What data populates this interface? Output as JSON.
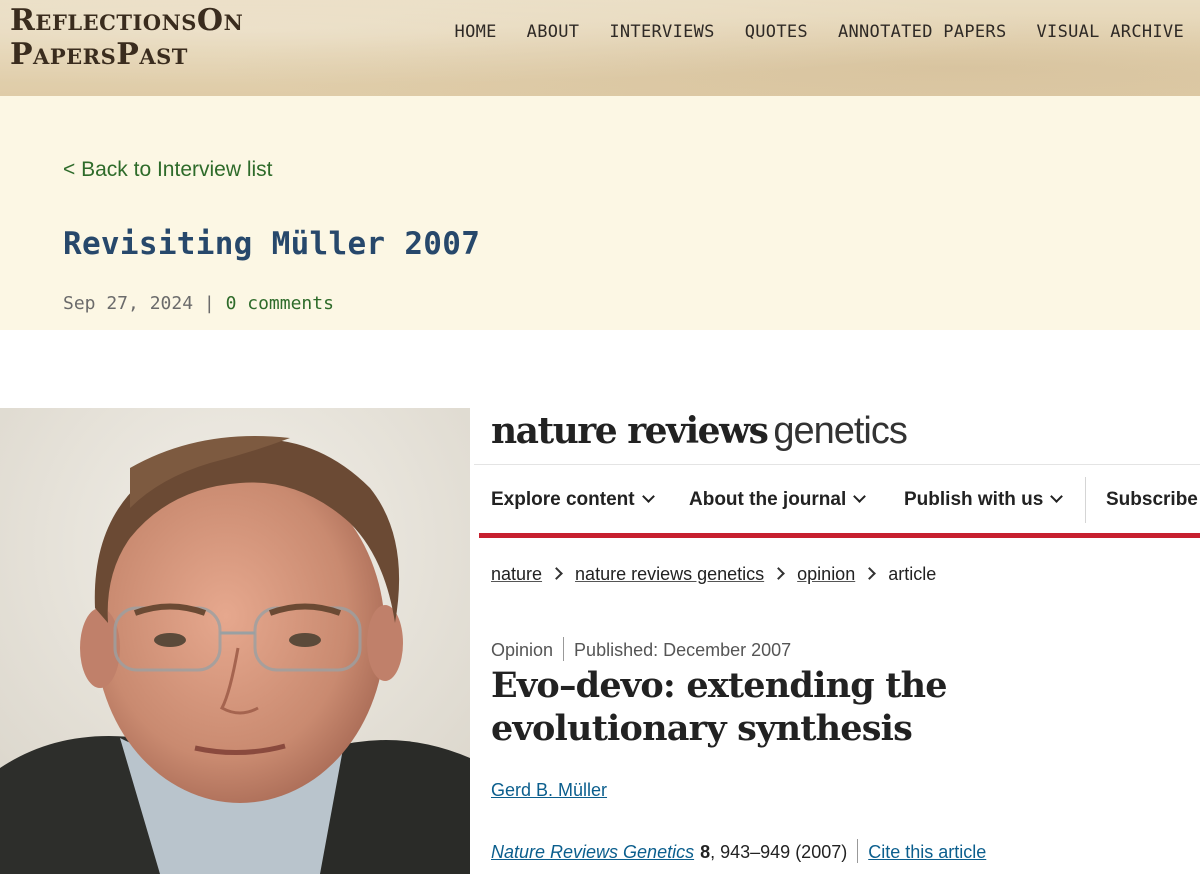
{
  "site": {
    "logo_line1": "ReflectionsOn",
    "logo_line2": "PapersPast",
    "nav": [
      {
        "label": "HOME"
      },
      {
        "label": "ABOUT"
      },
      {
        "label": "INTERVIEWS"
      },
      {
        "label": "QUOTES"
      },
      {
        "label": "ANNOTATED PAPERS"
      },
      {
        "label": "VISUAL ARCHIVE"
      }
    ]
  },
  "post": {
    "back_link": "< Back to Interview list",
    "title": "Revisiting Müller 2007",
    "date": "Sep 27, 2024",
    "separator": "|",
    "comments": "0 comments"
  },
  "embed": {
    "brand_bold": "nature reviews",
    "brand_light": "genetics",
    "nav": [
      {
        "label": "Explore content"
      },
      {
        "label": "About the journal"
      },
      {
        "label": "Publish with us"
      },
      {
        "label": "Subscribe"
      }
    ],
    "breadcrumbs": [
      "nature",
      "nature reviews genetics",
      "opinion",
      "article"
    ],
    "article_type": "Opinion",
    "published": "Published: December 2007",
    "title": "Evo–devo: extending the evolutionary synthesis",
    "author": "Gerd B. Müller",
    "journal": "Nature Reviews Genetics",
    "volume": "8",
    "pages_year": ", 943–949 (2007)",
    "cite_label": "Cite this article"
  },
  "colors": {
    "header_bg": "#e3d2b0",
    "post_band_bg": "#fcf7e4",
    "link_green": "#2e6b2a",
    "title_blue": "#27486b",
    "nature_red": "#c7202f",
    "nature_link": "#0b5e8d"
  }
}
